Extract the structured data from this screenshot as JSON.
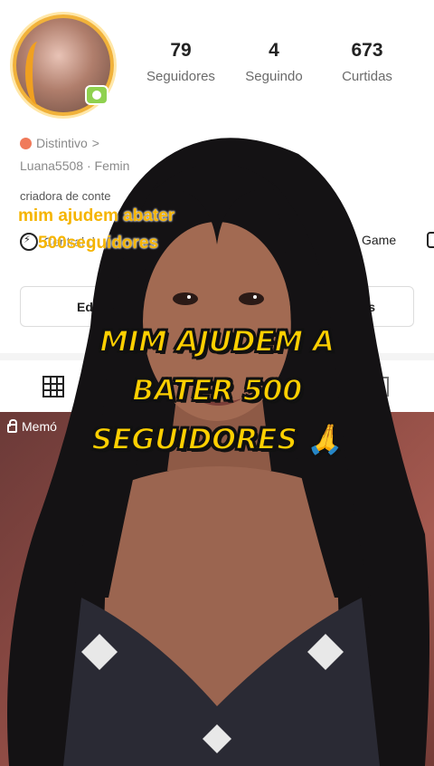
{
  "profile": {
    "stats": [
      {
        "value": "79",
        "label": "Seguidores"
      },
      {
        "value": "4",
        "label": "Seguindo"
      },
      {
        "value": "673",
        "label": "Curtidas"
      }
    ],
    "badge_label": "Distintivo",
    "badge_chevron": ">",
    "username_line": "Luana5508 · Femin",
    "bio": "criadora de conte",
    "link_text": "Central d",
    "game_label": "Game"
  },
  "buttons": {
    "edit": "Edit",
    "right": "s"
  },
  "tabs": {
    "memo_label": "Memó"
  },
  "overlay": {
    "small_caption_line1": "mim ajudem abater",
    "small_caption_line2": "500seguidores",
    "main_caption": [
      "MIM AJUDEM A",
      "BATER 500",
      "SEGUIDORES 🙏"
    ]
  },
  "colors": {
    "caption_yellow": "#ffd000",
    "small_caption_yellow": "#f5b400",
    "avatar_ring": "#f1b23a"
  }
}
